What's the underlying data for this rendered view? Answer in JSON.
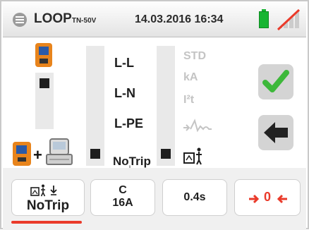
{
  "header": {
    "title": "LOOP",
    "title_sub": "TN-50V",
    "datetime": "14.03.2016 16:34",
    "menu_icon": "menu-icon",
    "battery_icon": "battery-full-icon",
    "signal_icon": "no-wireless-signal-icon"
  },
  "main": {
    "mode_options": [
      "L-L",
      "L-N",
      "L-PE",
      "NoTrip"
    ],
    "calc_options": [
      "STD",
      "kA",
      "I²t"
    ],
    "confirm_icon": "checkmark-icon",
    "back_icon": "arrow-left-icon",
    "probe_icons": [
      "tester-icon",
      "tester-plus-remote-probe-icon"
    ],
    "earth_symbol": "⏚"
  },
  "footer": {
    "buttons": [
      {
        "line1": "",
        "line2": "NoTrip",
        "icon": "rcd-earth-icon"
      },
      {
        "line1": "C",
        "line2": "16A"
      },
      {
        "line1": "",
        "line2": "0.4s"
      },
      {
        "line1": "",
        "line2": "0",
        "icon": "zero-arrows-icon"
      }
    ]
  },
  "colors": {
    "accent_red": "#ea3a2a",
    "check_green": "#3db83a",
    "battery_green": "#17b532",
    "tester_orange": "#e8841c"
  }
}
